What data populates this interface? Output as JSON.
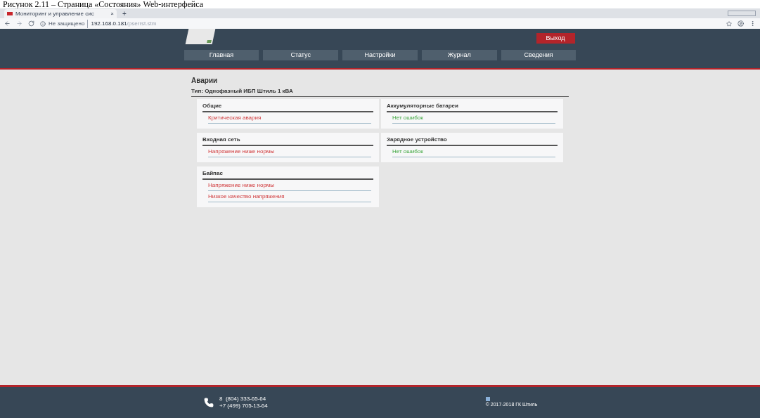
{
  "caption": "Рисунок 2.11 – Страница «Состояния» Web-интерфейса",
  "browser": {
    "tab_title": "Мониторинг и управление сис",
    "tab_close": "×",
    "new_tab": "+",
    "security": "Не защищено",
    "url_host": "192.168.0.181",
    "url_path": "/pserrst.stm"
  },
  "header": {
    "logout": "Выход",
    "nav": [
      {
        "label": "Главная",
        "selected": false
      },
      {
        "label": "Статус",
        "selected": false
      },
      {
        "label": "Настройки",
        "selected": false
      },
      {
        "label": "Журнал",
        "selected": false
      },
      {
        "label": "Сведения",
        "selected": false
      }
    ]
  },
  "page": {
    "title": "Аварии",
    "subtitle": "Тип: Однофазный ИБП Штиль 1 кВА",
    "groups": [
      {
        "title": "Общие",
        "items": [
          {
            "text": "Критическая авария",
            "kind": "alarm"
          }
        ]
      },
      {
        "title": "Аккумуляторные батареи",
        "items": [
          {
            "text": "Нет ошибок",
            "kind": "ok"
          }
        ]
      },
      {
        "title": "Входная сеть",
        "items": [
          {
            "text": "Напряжение ниже нормы",
            "kind": "alarm"
          }
        ]
      },
      {
        "title": "Зарядное устройство",
        "items": [
          {
            "text": "Нет ошибок",
            "kind": "ok"
          }
        ]
      },
      {
        "title": "Байпас",
        "items": [
          {
            "text": "Напряжение ниже нормы",
            "kind": "alarm"
          },
          {
            "text": "Низкое качество напряжения",
            "kind": "alarm"
          }
        ]
      }
    ]
  },
  "footer": {
    "phones": [
      "8  (804) 333-65-64",
      "+7 (499) 705-13-64"
    ],
    "copyright": "© 2017-2018 ГК Штиль"
  }
}
